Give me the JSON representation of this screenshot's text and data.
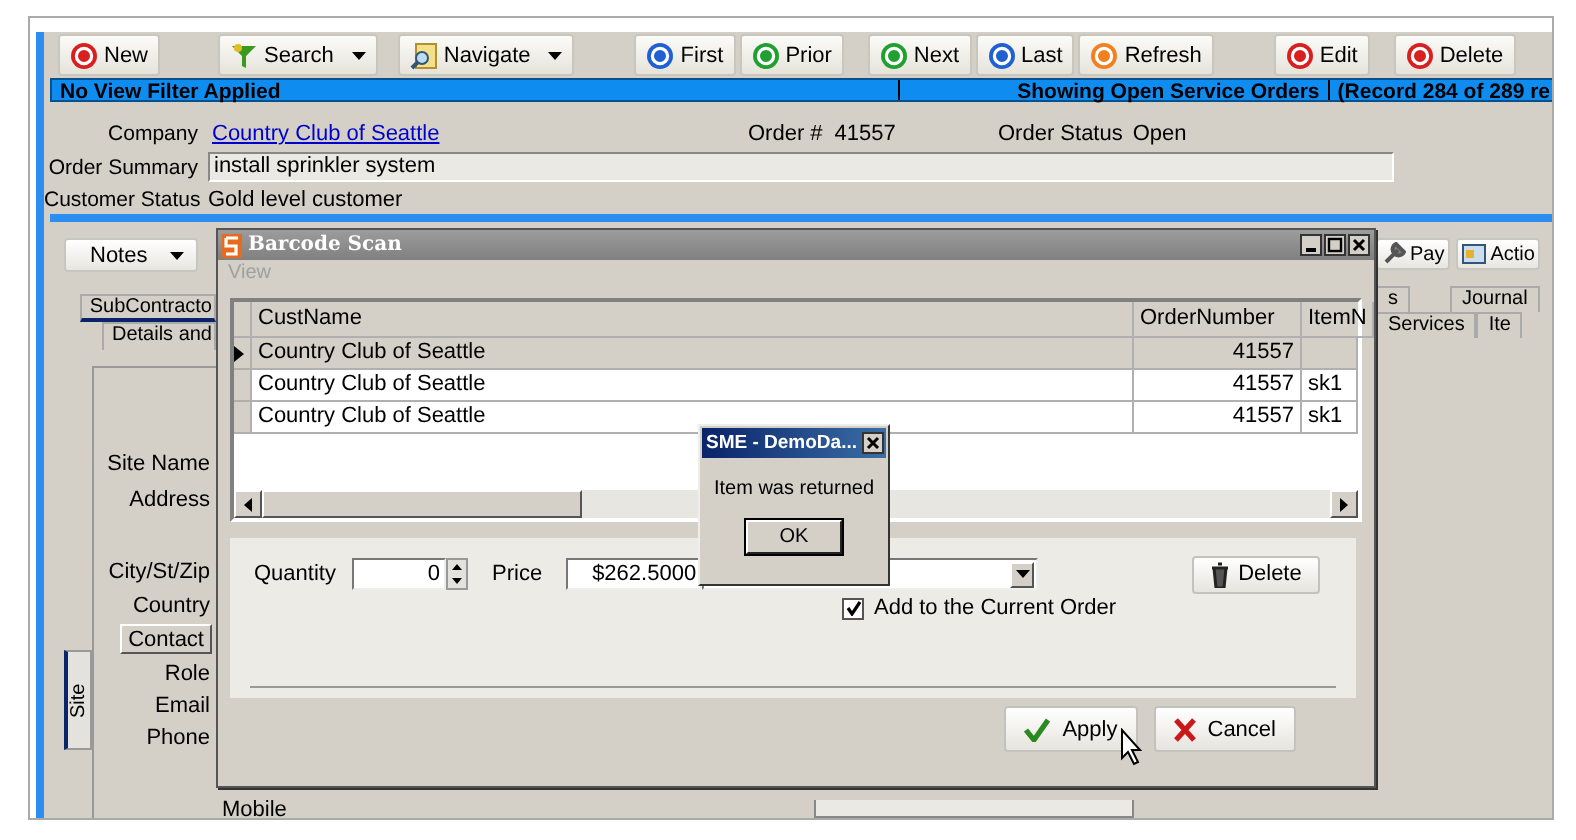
{
  "toolbar": [
    {
      "label": "New",
      "kind": "circle",
      "color": "#d82020",
      "dropdown": false
    },
    {
      "label": "Search",
      "kind": "funnel",
      "dropdown": true
    },
    {
      "label": "Navigate",
      "kind": "magnifier",
      "dropdown": true
    },
    {
      "label": "First",
      "kind": "circle",
      "color": "#2060d0",
      "dropdown": false
    },
    {
      "label": "Prior",
      "kind": "circle",
      "color": "#20a030",
      "dropdown": false
    },
    {
      "label": "Next",
      "kind": "circle",
      "color": "#20a030",
      "dropdown": false
    },
    {
      "label": "Last",
      "kind": "circle",
      "color": "#2060d0",
      "dropdown": false
    },
    {
      "label": "Refresh",
      "kind": "circle",
      "color": "#f08020",
      "dropdown": false
    },
    {
      "label": "Edit",
      "kind": "circle",
      "color": "#d82020",
      "dropdown": false
    },
    {
      "label": "Delete",
      "kind": "circle",
      "color": "#d82020",
      "dropdown": false
    }
  ],
  "status_bar": {
    "filter": "No View Filter Applied",
    "view": "Showing Open Service Orders",
    "record": "(Record 284 of 289 re"
  },
  "order": {
    "company_label": "Company",
    "company": "Country Club of Seattle",
    "order_number_label": "Order #",
    "order_number": "41557",
    "status_label": "Order Status",
    "status": "Open",
    "summary_label": "Order Summary",
    "summary": "install sprinkler system",
    "customer_status_label": "Customer Status",
    "customer_status": "Gold level customer"
  },
  "left_panel": {
    "notes_button": "Notes",
    "tabs": [
      {
        "label": "SubContracto",
        "selected": true
      },
      {
        "label": "Details and",
        "selected": false
      }
    ],
    "fields": [
      {
        "kind": "label",
        "label": "Site Name"
      },
      {
        "kind": "label",
        "label": "Address"
      },
      {
        "kind": "label",
        "label": "City/St/Zip"
      },
      {
        "kind": "label",
        "label": "Country"
      },
      {
        "kind": "button",
        "label": "Contact"
      },
      {
        "kind": "label",
        "label": "Role"
      },
      {
        "kind": "label",
        "label": "Email"
      },
      {
        "kind": "label",
        "label": "Phone"
      }
    ],
    "side_tabs": [
      {
        "label": "Site",
        "selected": true
      }
    ]
  },
  "mobile_label": "Mobile",
  "right_panel": {
    "buttons": [
      {
        "label": "Pay",
        "kind": "pay"
      },
      {
        "label": "Actio",
        "kind": "action"
      }
    ],
    "tabs_row1": [
      "s",
      "Journal"
    ],
    "tabs_row2": [
      "Services",
      "Ite"
    ]
  },
  "barcode_dialog": {
    "title": "Barcode Scan",
    "menu": [
      {
        "label": "View",
        "disabled": true
      }
    ],
    "grid": {
      "columns": [
        "CustName",
        "OrderNumber",
        "ItemN"
      ],
      "rows": [
        {
          "selected": true,
          "cust_name": "Country Club of Seattle",
          "order_number": "41557"
        },
        {
          "selected": false,
          "cust_name": "Country Club of Seattle",
          "order_number": "41557",
          "item": "sk1"
        },
        {
          "selected": false,
          "cust_name": "Country Club of Seattle",
          "order_number": "41557",
          "item": "sk1"
        }
      ]
    },
    "quantity_label": "Quantity",
    "quantity": "0",
    "price_label": "Price",
    "price": "$262.5000",
    "delete_button": "Delete",
    "add_to_order": {
      "label": "Add to the Current Order",
      "checked": true
    },
    "buttons": [
      {
        "kind": "apply",
        "label": "Apply"
      },
      {
        "kind": "cancel",
        "label": "Cancel"
      }
    ]
  },
  "message_box": {
    "title": "SME - DemoDa...",
    "message": "Item was returned",
    "button": "OK"
  }
}
